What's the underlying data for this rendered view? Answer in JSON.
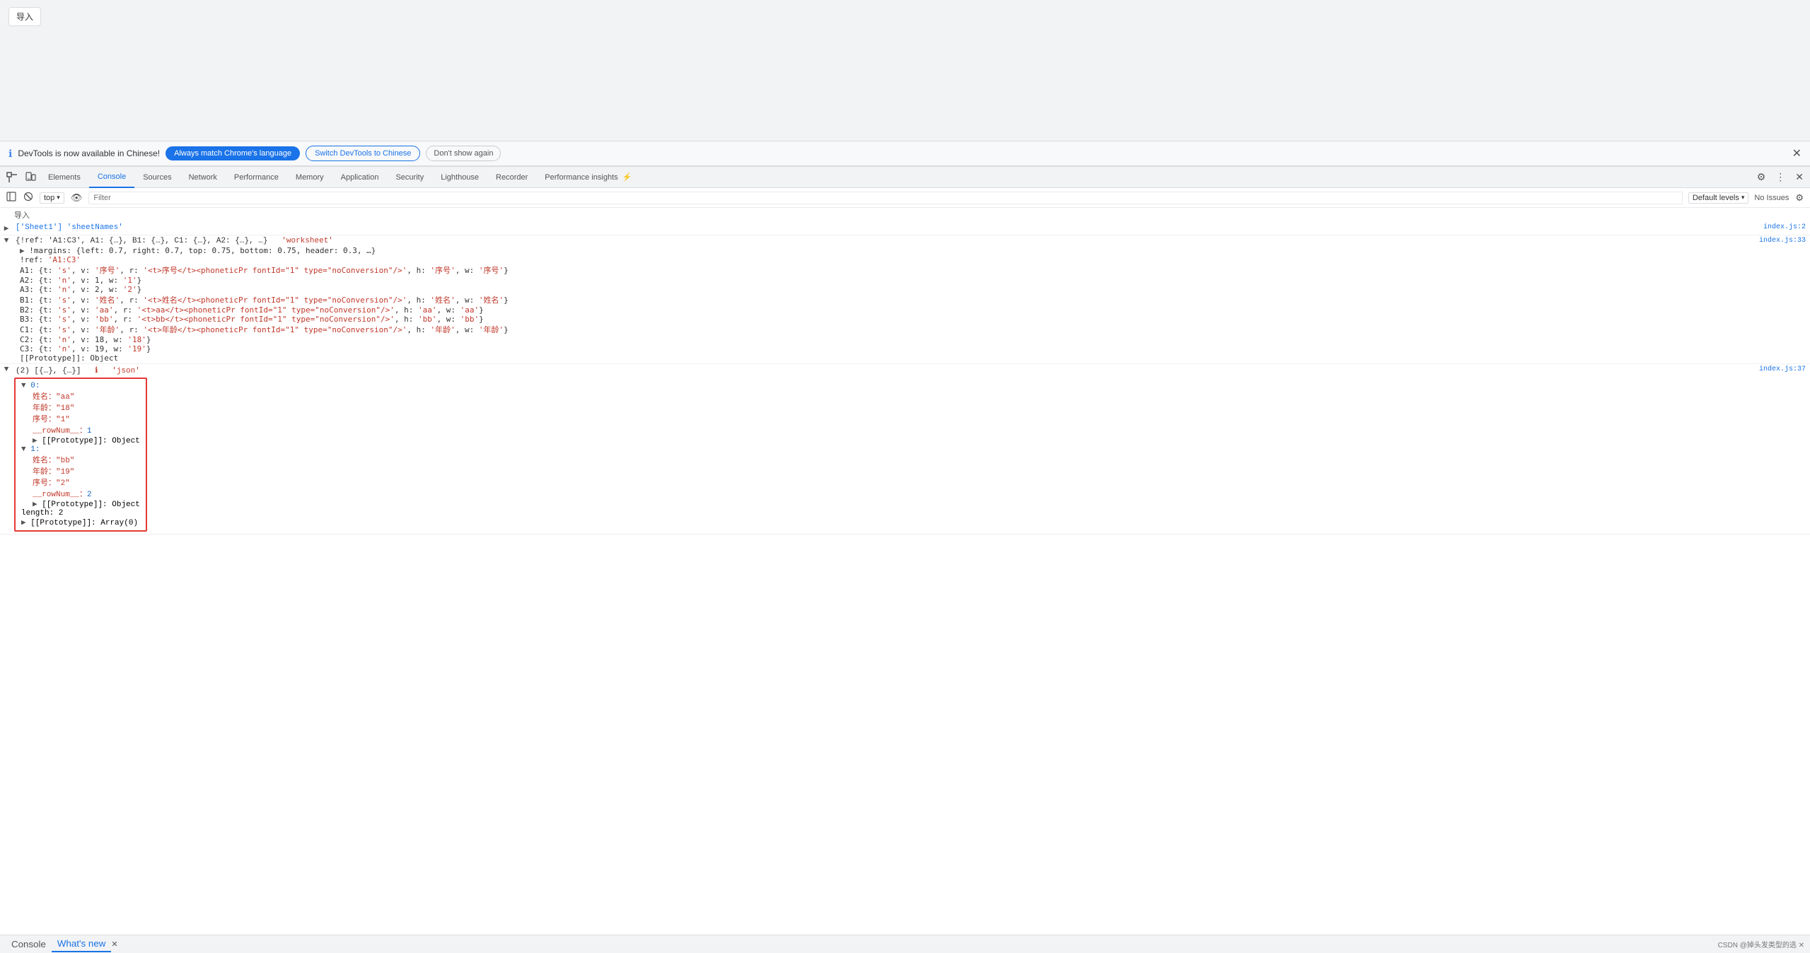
{
  "browser": {
    "import_btn": "导入"
  },
  "notification": {
    "icon": "ℹ",
    "text": "DevTools is now available in Chinese!",
    "btn_match": "Always match Chrome's language",
    "btn_switch": "Switch DevTools to Chinese",
    "btn_dont_show": "Don't show again",
    "close": "✕"
  },
  "devtools": {
    "tabs": [
      {
        "id": "elements",
        "label": "Elements",
        "active": false
      },
      {
        "id": "console",
        "label": "Console",
        "active": true
      },
      {
        "id": "sources",
        "label": "Sources",
        "active": false
      },
      {
        "id": "network",
        "label": "Network",
        "active": false
      },
      {
        "id": "performance",
        "label": "Performance",
        "active": false
      },
      {
        "id": "memory",
        "label": "Memory",
        "active": false
      },
      {
        "id": "application",
        "label": "Application",
        "active": false
      },
      {
        "id": "security",
        "label": "Security",
        "active": false
      },
      {
        "id": "lighthouse",
        "label": "Lighthouse",
        "active": false
      },
      {
        "id": "recorder",
        "label": "Recorder",
        "active": false
      },
      {
        "id": "perf-insights",
        "label": "Performance insights",
        "active": false
      }
    ],
    "toolbar": {
      "context": "top",
      "filter_placeholder": "Filter",
      "levels": "Default levels",
      "no_issues": "No Issues",
      "eye_icon": "👁"
    }
  },
  "console_lines": [
    {
      "id": "line1",
      "expanded": false,
      "expand_char": "▶",
      "content": "['Sheet1'] 'sheetNames'",
      "content_color": "blue",
      "file": "index.js:2"
    },
    {
      "id": "line2",
      "expanded": true,
      "expand_char": "▼",
      "content": "{!ref: 'A1:C3', A1: {…}, B1: {…}, C1: {…}, A2: {…}, …} 'worksheet'",
      "content_color": "dark",
      "file": "index.js:33",
      "children": [
        "▶ !margins: {left: 0.7, right: 0.7, top: 0.75, bottom: 0.75, header: 0.3, …}",
        "!ref: 'A1:C3'",
        "A1: {t: 's', v: '序号', r: '<t>序号</t><phoneticPr fontId=\"1\" type=\"noConversion\"/>', h: '序号', w: '序号'}",
        "A2: {t: 'n', v: 1, w: '1'}",
        "A3: {t: 'n', v: 2, w: '2'}",
        "B1: {t: 's', v: '姓名', r: '<t>姓名</t><phoneticPr fontId=\"1\" type=\"noConversion\"/>', h: '姓名', w: '姓名'}",
        "B2: {t: 's', v: 'aa', r: '<t>aa</t><phoneticPr fontId=\"1\" type=\"noConversion\"/>', h: 'aa', w: 'aa'}",
        "B3: {t: 's', v: 'bb', r: '<t>bb</t><phoneticPr fontId=\"1\" type=\"noConversion\"/>', h: 'bb', w: 'bb'}",
        "C1: {t: 's', v: '年龄', r: '<t>年龄</t><phoneticPr fontId=\"1\" type=\"noConversion\"/>', h: '年龄', w: '年龄'}",
        "C2: {t: 'n', v: 18, w: '18'}",
        "C3: {t: 'n', v: 19, w: '19'}",
        "[[Prototype]]: Object"
      ]
    },
    {
      "id": "line3",
      "expanded": true,
      "expand_char": "▼",
      "content": "(2) [{…}, {…}] 'json'",
      "content_color": "dark",
      "file": "index.js:37",
      "has_box": true
    }
  ],
  "json_box": {
    "items": [
      {
        "index": "0:",
        "expanded": true,
        "fields": [
          {
            "key": "姓名：",
            "val": "\"aa\"",
            "val_type": "str"
          },
          {
            "key": "年龄：",
            "val": "\"18\"",
            "val_type": "str"
          },
          {
            "key": "序号：",
            "val": "\"1\"",
            "val_type": "str"
          },
          {
            "key": "__rowNum__：",
            "val": "1",
            "val_type": "num"
          }
        ],
        "proto": "▶ [[Prototype]]: Object"
      },
      {
        "index": "1:",
        "expanded": true,
        "fields": [
          {
            "key": "姓名：",
            "val": "\"bb\"",
            "val_type": "str"
          },
          {
            "key": "年龄：",
            "val": "\"19\"",
            "val_type": "str"
          },
          {
            "key": "序号：",
            "val": "\"2\"",
            "val_type": "str"
          },
          {
            "key": "__rowNum__：",
            "val": "2",
            "val_type": "num"
          }
        ],
        "proto": "▶ [[Prototype]]: Object"
      }
    ],
    "length": "length: 2",
    "array_proto": "▶ [[Prototype]]: Array(0)"
  },
  "status_bar": {
    "console_tab": "Console",
    "whats_new_tab": "What's new",
    "close_icon": "✕",
    "right_text": "CSDN @掉头发类型的选 ✕"
  },
  "icons": {
    "inspect": "⊡",
    "device": "⊟",
    "clear": "🚫",
    "settings": "⚙",
    "more": "⋮",
    "close": "✕",
    "search": "🔍",
    "console_settings": "⚙"
  }
}
